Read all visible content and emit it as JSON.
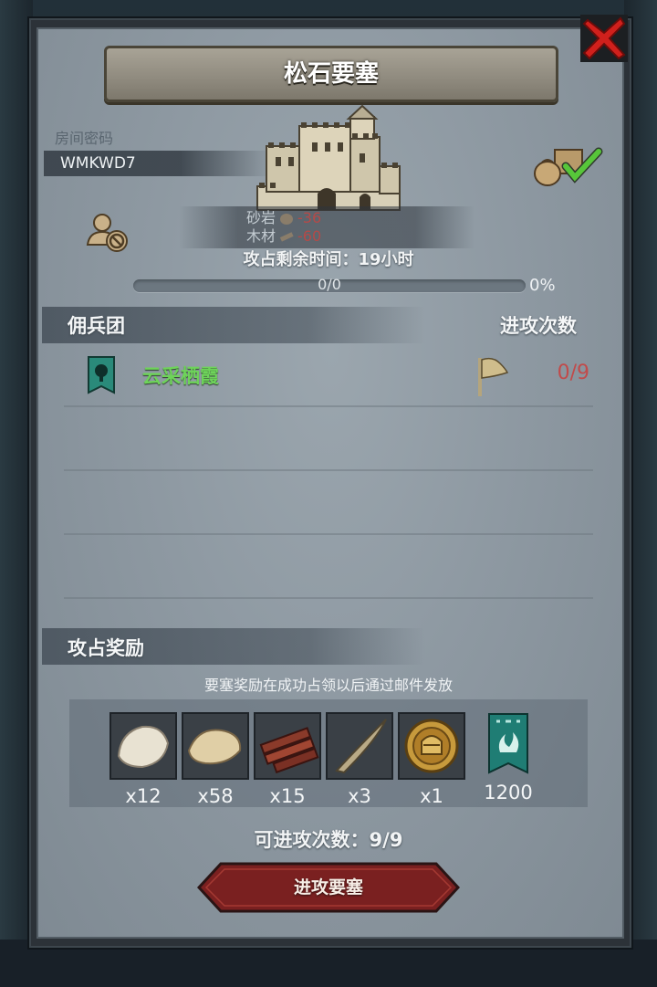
{
  "title": "松石要塞",
  "room": {
    "label": "房间密码",
    "code": "WMKWD7"
  },
  "resources": [
    {
      "name": "砂岩",
      "icon": "sandstone-icon",
      "value": "-36"
    },
    {
      "name": "木材",
      "icon": "wood-icon",
      "value": "-60"
    }
  ],
  "time_left": "攻占剩余时间：19小时",
  "progress": {
    "text": "0/0",
    "percent": "0%",
    "fraction": 0
  },
  "mercenary": {
    "header_left": "佣兵团",
    "header_right": "进攻次数"
  },
  "guilds": [
    {
      "name": "云采栖霞",
      "attacks": "0/9",
      "badge_color": "#2a8a7a"
    }
  ],
  "rewards_section": {
    "title": "攻占奖励",
    "note": "要塞奖励在成功占领以后通过邮件发放",
    "items": [
      {
        "icon": "white-fur-icon",
        "qty": "x12"
      },
      {
        "icon": "leather-hide-icon",
        "qty": "x58"
      },
      {
        "icon": "wood-planks-icon",
        "qty": "x15"
      },
      {
        "icon": "horn-icon",
        "qty": "x3"
      },
      {
        "icon": "knight-helmet-coin-icon",
        "qty": "x1"
      },
      {
        "icon": "guild-banner-icon",
        "qty": "1200"
      }
    ]
  },
  "remaining_attacks": "可进攻次数：9/9",
  "attack_button": "进攻要塞",
  "colors": {
    "accent_green": "#6ed35a",
    "count_red": "#c14b4b",
    "button_red": "#7a2020"
  }
}
